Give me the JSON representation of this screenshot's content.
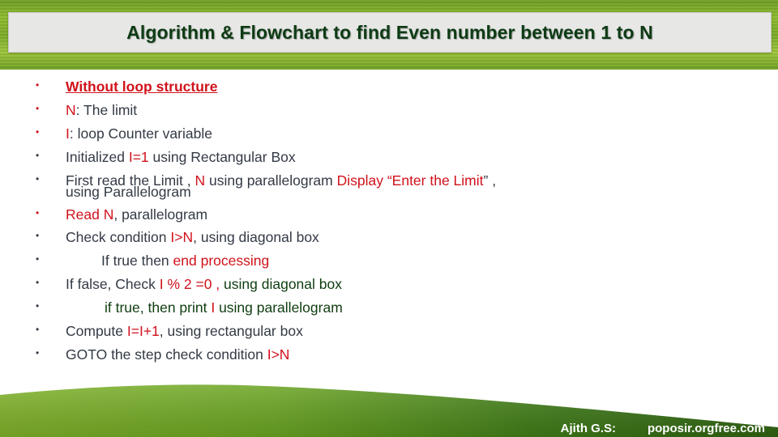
{
  "title": "Algorithm & Flowchart to find Even number between 1 to N",
  "items": [
    {
      "parts": [
        {
          "t": "Without loop structure",
          "c": "red bold ul"
        }
      ]
    },
    {
      "parts": [
        {
          "t": "N",
          "c": "red"
        },
        {
          "t": ": The limit",
          "c": ""
        }
      ]
    },
    {
      "parts": [
        {
          "t": "I",
          "c": "red"
        },
        {
          "t": ": loop Counter variable",
          "c": ""
        }
      ]
    },
    {
      "parts": [
        {
          "t": "Initialized ",
          "c": ""
        },
        {
          "t": "I=1",
          "c": "red"
        },
        {
          "t": " using Rectangular Box",
          "c": ""
        }
      ]
    },
    {
      "parts": [
        {
          "t": "First read the Limit , ",
          "c": ""
        },
        {
          "t": "N",
          "c": "red"
        },
        {
          "t": " using parallelogram ",
          "c": ""
        },
        {
          "t": "Display “Enter the Limit",
          "c": "red"
        },
        {
          "t": "” ,",
          "c": ""
        }
      ],
      "line2": "using Parallelogram"
    },
    {
      "parts": [
        {
          "t": "Read N",
          "c": "red"
        },
        {
          "t": ", parallelogram",
          "c": ""
        }
      ]
    },
    {
      "parts": [
        {
          "t": "Check condition ",
          "c": ""
        },
        {
          "t": "I>N",
          "c": "red"
        },
        {
          "t": ", using diagonal box",
          "c": ""
        }
      ]
    },
    {
      "indent": 1,
      "parts": [
        {
          "t": "If true  then ",
          "c": ""
        },
        {
          "t": "end processing",
          "c": "red"
        }
      ]
    },
    {
      "parts": [
        {
          "t": "If false, Check ",
          "c": ""
        },
        {
          "t": "I % 2 =0 , ",
          "c": "red"
        },
        {
          "t": "using diagonal box",
          "c": "green"
        }
      ]
    },
    {
      "indent": 2,
      "parts": [
        {
          "t": "if true, then print ",
          "c": "green"
        },
        {
          "t": "I",
          "c": "red"
        },
        {
          "t": " using parallelogram",
          "c": "green"
        }
      ]
    },
    {
      "parts": [
        {
          "t": "Compute ",
          "c": ""
        },
        {
          "t": "I=I+1",
          "c": "red"
        },
        {
          "t": ", using rectangular box",
          "c": ""
        }
      ]
    },
    {
      "parts": [
        {
          "t": "GOTO the step check condition ",
          "c": ""
        },
        {
          "t": "I>N",
          "c": "red"
        }
      ]
    }
  ],
  "bullet_colors": [
    "#d0121b",
    "#d0121b",
    "#d0121b",
    "#333a45",
    "#333a45",
    "#d0121b",
    "#333a45",
    "#333a45",
    "#333a45",
    "#333a45",
    "#333a45",
    "#333a45"
  ],
  "footer": {
    "author": "Ajith G.S:",
    "site": "poposir.orgfree.com"
  }
}
